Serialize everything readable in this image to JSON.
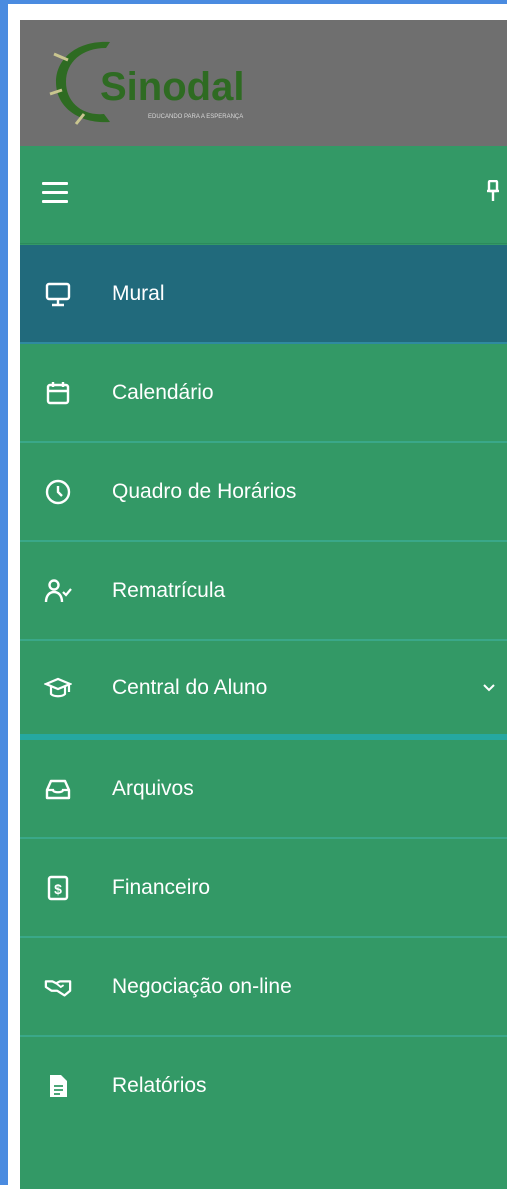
{
  "brand": {
    "name": "Sinodal",
    "tagline": "EDUCANDO PARA A ESPERANÇA",
    "colors": {
      "logo_green": "#2e6b22",
      "logo_ring": "#c9c58f"
    }
  },
  "colors": {
    "sidebar_bg": "#339966",
    "active_bg": "#216a7c",
    "logo_bg": "#6f6f6f",
    "frame": "#4a8be0"
  },
  "header": {
    "menu_icon": "hamburger-icon",
    "pin_icon": "pin-icon"
  },
  "menu": {
    "items": [
      {
        "label": "Mural",
        "icon": "monitor-icon",
        "active": true
      },
      {
        "label": "Calendário",
        "icon": "calendar-icon"
      },
      {
        "label": "Quadro de Horários",
        "icon": "clock-icon"
      },
      {
        "label": "Rematrícula",
        "icon": "user-check-icon"
      },
      {
        "label": "Central do Aluno",
        "icon": "graduation-cap-icon",
        "expandable": true
      },
      {
        "label": "Arquivos",
        "icon": "inbox-icon"
      },
      {
        "label": "Financeiro",
        "icon": "dollar-file-icon"
      },
      {
        "label": "Negociação on-line",
        "icon": "handshake-icon"
      },
      {
        "label": "Relatórios",
        "icon": "document-icon"
      }
    ]
  }
}
